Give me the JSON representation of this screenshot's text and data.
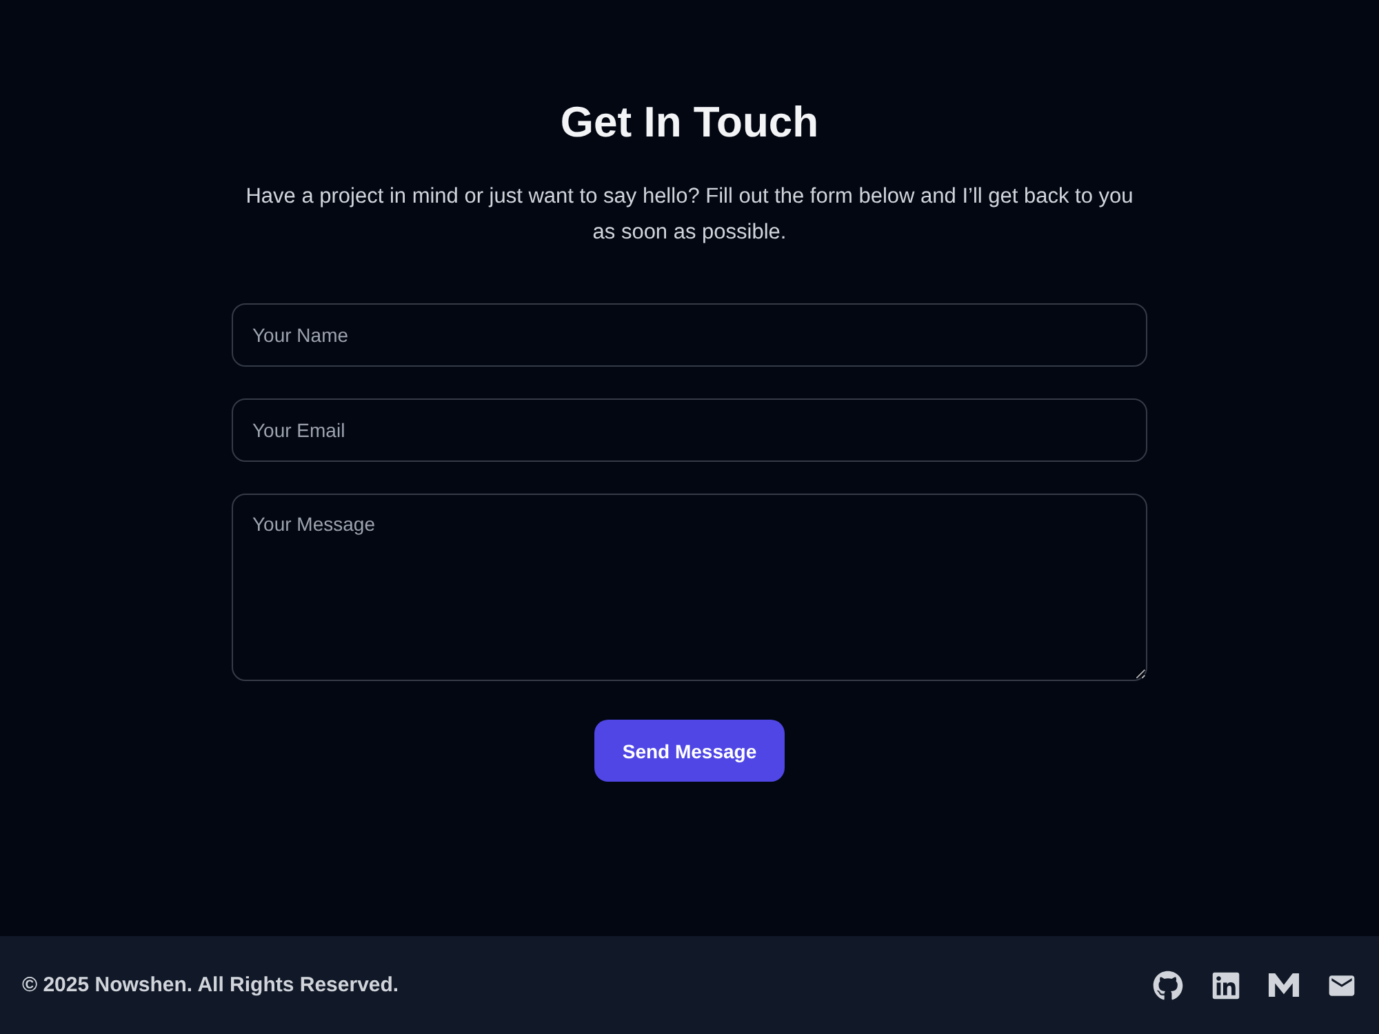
{
  "contact": {
    "heading": "Get In Touch",
    "intro": "Have a project in mind or just want to say hello? Fill out the form below and I’ll get back to you as soon as possible."
  },
  "form": {
    "fields": [
      {
        "kind": "input",
        "placeholder": "Your Name"
      },
      {
        "kind": "input",
        "placeholder": "Your Email"
      },
      {
        "kind": "textarea",
        "placeholder": "Your Message"
      }
    ],
    "submit": "Send Message"
  },
  "footer": {
    "copyright": "© 2025 Nowshen. All Rights Reserved.",
    "links": [
      {
        "kind": "github"
      },
      {
        "kind": "linkedin"
      },
      {
        "kind": "medium"
      },
      {
        "kind": "mail"
      }
    ]
  }
}
